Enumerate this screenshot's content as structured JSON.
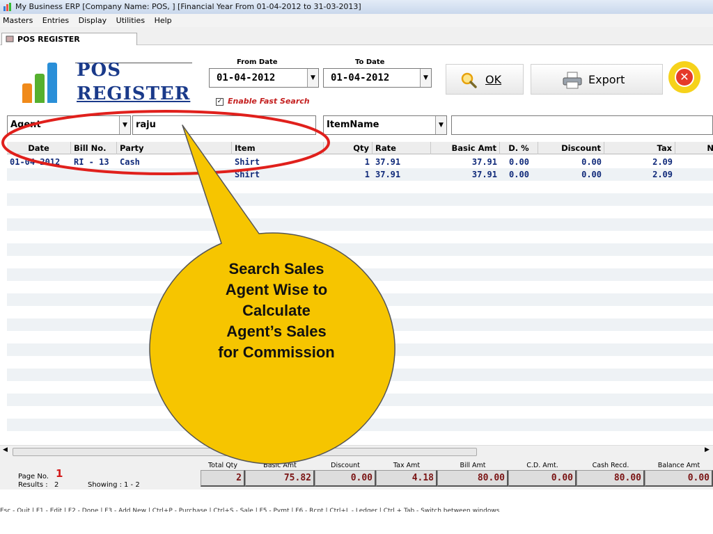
{
  "window": {
    "title": "My Business ERP [Company Name: POS, ] [Financial Year From 01-04-2012 to 31-03-2013]"
  },
  "menu": [
    "Masters",
    "Entries",
    "Display",
    "Utilities",
    "Help"
  ],
  "tab": {
    "label": "POS REGISTER"
  },
  "header": {
    "title_line1": "POS",
    "title_line2": "REGISTER"
  },
  "dates": {
    "from_label": "From Date",
    "from_value": "01-04-2012",
    "to_label": "To Date",
    "to_value": "01-04-2012"
  },
  "fast_search": {
    "label": "Enable Fast Search",
    "checked": true
  },
  "buttons": {
    "ok": "OK",
    "export": "Export"
  },
  "filters": {
    "field1": "Agent",
    "value1": "raju",
    "field2": "ItemName",
    "value2": ""
  },
  "table": {
    "columns": [
      "Date",
      "Bill No.",
      "Party",
      "Item",
      "Qty",
      "Rate",
      "Basic Amt",
      "D. %",
      "Discount",
      "Tax",
      "N"
    ],
    "rows": [
      [
        "01-04-2012",
        "RI - 13",
        "Cash",
        "Shirt",
        "1",
        "37.91",
        "37.91",
        "0.00",
        "0.00",
        "2.09"
      ],
      [
        "",
        "",
        "",
        "Shirt",
        "1",
        "37.91",
        "37.91",
        "0.00",
        "0.00",
        "2.09"
      ]
    ]
  },
  "scrollbar": {
    "grip": "III"
  },
  "footer": {
    "page_label": "Page No.",
    "page_value": "1",
    "results_label": "Results :",
    "results_value": "2",
    "showing_label": "Showing :",
    "showing_value": "1 - 2",
    "totals_labels": [
      "Total Qty",
      "Basic Amt",
      "Discount",
      "Tax Amt",
      "Bill Amt",
      "C.D. Amt.",
      "Cash Recd.",
      "Balance Amt"
    ],
    "totals_values": [
      "2",
      "75.82",
      "0.00",
      "4.18",
      "80.00",
      "0.00",
      "80.00",
      "0.00"
    ]
  },
  "statusbar": {
    "text": "Esc - Quit  |  F1 - Edit  |  F2 - Done  |  F3 - Add New  |  Ctrl+P - Purchase  |  Ctrl+S - Sale  |  F5 - Pymt  |  F6 - Rcpt  |  Ctrl+L - Ledger  |        Ctrl + Tab - Switch between windows"
  },
  "callout": {
    "lines": [
      "Search Sales",
      "Agent Wise to",
      "Calculate",
      "Agent’s Sales",
      "for Commission"
    ]
  },
  "colors": {
    "callout_fill": "#f6c500",
    "highlight_ring": "#e0201c",
    "title_blue": "#1a3a8a",
    "row_text": "#102a7a"
  }
}
